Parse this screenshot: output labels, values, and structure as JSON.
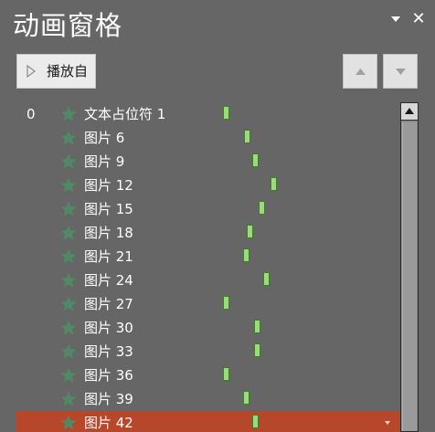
{
  "pane": {
    "title": "动画窗格",
    "close_glyph": "✕",
    "options_icon": "dropdown-triangle-icon",
    "close_icon": "close-icon"
  },
  "toolbar": {
    "play_label": "播放自",
    "play_icon": "play-triangle-icon",
    "move_up_icon": "move-up-icon",
    "move_down_icon": "move-down-icon"
  },
  "colors": {
    "background": "#666666",
    "selected_row": "#b7472a",
    "star_icon": "#4f8a64",
    "timing_bar_fill": "#9bdb7a",
    "timing_bar_border": "#3f7a2e"
  },
  "animation_list": {
    "effect_icon": "star-entrance-icon",
    "items": [
      {
        "number": "0",
        "label": "文本占位符 1"
      },
      {
        "number": "",
        "label": "图片 6"
      },
      {
        "number": "",
        "label": "图片 9"
      },
      {
        "number": "",
        "label": "图片 12"
      },
      {
        "number": "",
        "label": "图片 15"
      },
      {
        "number": "",
        "label": "图片 18"
      },
      {
        "number": "",
        "label": "图片 21"
      },
      {
        "number": "",
        "label": "图片 24"
      },
      {
        "number": "",
        "label": "图片 27"
      },
      {
        "number": "",
        "label": "图片 30"
      },
      {
        "number": "",
        "label": "图片 33"
      },
      {
        "number": "",
        "label": "图片 36"
      },
      {
        "number": "",
        "label": "图片 39"
      },
      {
        "number": "",
        "label": "图片 42",
        "selected": true
      }
    ]
  }
}
